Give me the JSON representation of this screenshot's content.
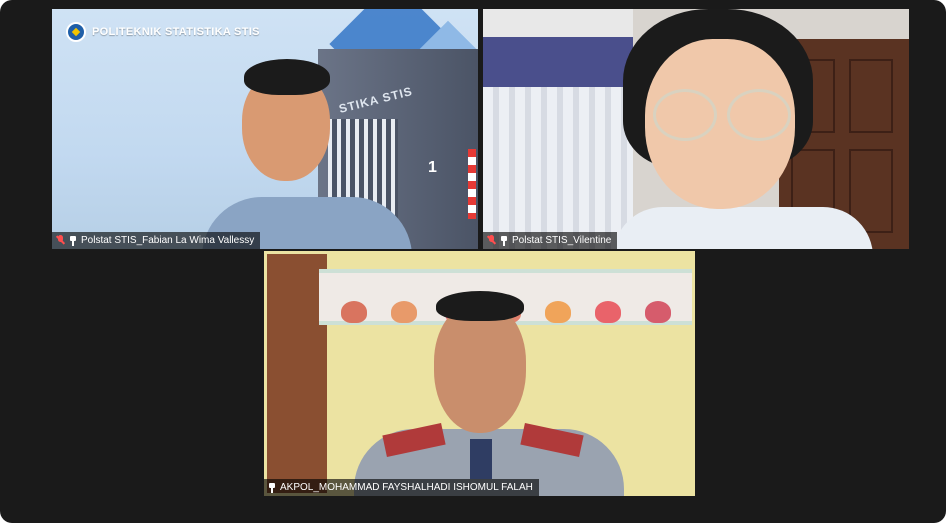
{
  "meeting": {
    "tiles": [
      {
        "id": "participant-1",
        "name": "Polstat STIS_Fabian La Wima Vallessy",
        "mic_muted": true,
        "pinned": true,
        "background_logo_text": "POLITEKNIK STATISTIKA STIS",
        "background_sign_text": "STIKA STIS",
        "background_number": "1"
      },
      {
        "id": "participant-2",
        "name": "Polstat STIS_Vilentine",
        "mic_muted": true,
        "pinned": true
      },
      {
        "id": "participant-3",
        "name": "AKPOL_MOHAMMAD FAYSHALHADI ISHOMUL FALAH",
        "mic_muted": false,
        "pinned": true,
        "active_speaker": true
      }
    ],
    "colors": {
      "active_speaker_border": "#c8d645",
      "muted_mic": "#ff4e4e",
      "background": "#1a1a1a"
    },
    "icons": [
      "mic-muted-icon",
      "pin-icon",
      "stis-logo-icon"
    ]
  }
}
